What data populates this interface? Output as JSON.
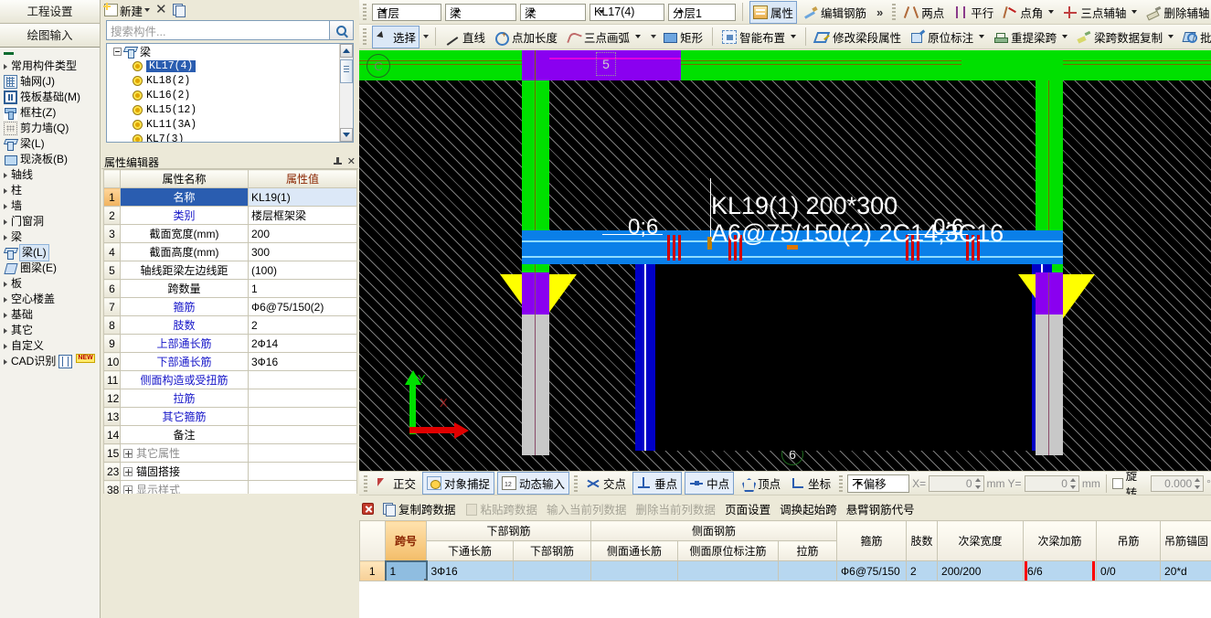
{
  "leftnav": {
    "tabs": [
      {
        "label": "工程设置"
      },
      {
        "label": "绘图输入"
      }
    ],
    "items": [
      {
        "label": "常用构件类型",
        "icon": "caret-right-icon"
      },
      {
        "label": "轴网(J)",
        "icon": "grid-icon"
      },
      {
        "label": "筏板基础(M)",
        "icon": "raft-foundation-icon"
      },
      {
        "label": "框柱(Z)",
        "icon": "frame-column-icon"
      },
      {
        "label": "剪力墙(Q)",
        "icon": "shear-wall-icon"
      },
      {
        "label": "梁(L)",
        "icon": "beam-icon"
      },
      {
        "label": "现浇板(B)",
        "icon": "slab-icon"
      },
      {
        "label": "轴线",
        "icon": "caret-right-icon"
      },
      {
        "label": "柱",
        "icon": "caret-right-icon"
      },
      {
        "label": "墙",
        "icon": "caret-right-icon"
      },
      {
        "label": "门窗洞",
        "icon": "caret-right-icon"
      },
      {
        "label": "梁",
        "icon": "caret-right-icon"
      },
      {
        "label": "梁(L)",
        "icon": "beam-icon",
        "selected": true
      },
      {
        "label": "圈梁(E)",
        "icon": "ring-beam-icon"
      },
      {
        "label": "板",
        "icon": "caret-right-icon"
      },
      {
        "label": "空心楼盖",
        "icon": "caret-right-icon"
      },
      {
        "label": "基础",
        "icon": "caret-right-icon"
      },
      {
        "label": "其它",
        "icon": "caret-right-icon"
      },
      {
        "label": "自定义",
        "icon": "caret-right-icon"
      },
      {
        "label": "CAD识别",
        "icon": "cad-recognition-icon",
        "badge": "NEW"
      }
    ]
  },
  "tree_panel": {
    "toolbar": {
      "new_label": "新建",
      "delete_icon": "close-x-icon",
      "copy_icon": "copy-icon"
    },
    "search": {
      "placeholder": "搜索构件...",
      "value": "",
      "button_icon": "search-icon"
    },
    "root": "梁",
    "nodes": [
      {
        "label": "KL17(4)",
        "selected": true
      },
      {
        "label": "KL18(2)",
        "selected": false
      },
      {
        "label": "KL16(2)",
        "selected": false
      },
      {
        "label": "KL15(12)",
        "selected": false
      },
      {
        "label": "KL11(3A)",
        "selected": false
      },
      {
        "label": "KL7(3)",
        "selected": false
      }
    ]
  },
  "property_editor": {
    "title": "属性编辑器",
    "pin_icon": "pin-icon",
    "close_icon": "close-icon",
    "headers": [
      "",
      "属性名称",
      "属性值"
    ],
    "rows": [
      {
        "idx": "1",
        "name": "名称",
        "value": "KL19(1)",
        "name_color": "blue",
        "selected": true
      },
      {
        "idx": "2",
        "name": "类别",
        "value": "楼层框架梁",
        "name_color": "blue",
        "selected": false
      },
      {
        "idx": "3",
        "name": "截面宽度(mm)",
        "value": "200",
        "name_color": "black",
        "selected": false
      },
      {
        "idx": "4",
        "name": "截面高度(mm)",
        "value": "300",
        "name_color": "black",
        "selected": false
      },
      {
        "idx": "5",
        "name": "轴线距梁左边线距",
        "value": "(100)",
        "name_color": "black",
        "selected": false
      },
      {
        "idx": "6",
        "name": "跨数量",
        "value": "1",
        "name_color": "black",
        "selected": false
      },
      {
        "idx": "7",
        "name": "箍筋",
        "value": "Ф6@75/150(2)",
        "name_color": "blue",
        "selected": false
      },
      {
        "idx": "8",
        "name": "肢数",
        "value": "2",
        "name_color": "blue",
        "selected": false
      },
      {
        "idx": "9",
        "name": "上部通长筋",
        "value": "2Ф14",
        "name_color": "blue",
        "selected": false
      },
      {
        "idx": "10",
        "name": "下部通长筋",
        "value": "3Ф16",
        "name_color": "blue",
        "selected": false
      },
      {
        "idx": "11",
        "name": "侧面构造或受扭筋",
        "value": "",
        "name_color": "blue",
        "selected": false
      },
      {
        "idx": "12",
        "name": "拉筋",
        "value": "",
        "name_color": "blue",
        "selected": false
      },
      {
        "idx": "13",
        "name": "其它箍筋",
        "value": "",
        "name_color": "blue",
        "selected": false
      },
      {
        "idx": "14",
        "name": "备注",
        "value": "",
        "name_color": "black",
        "selected": false
      },
      {
        "idx": "15",
        "name": "其它属性",
        "value": "",
        "expandable": true,
        "name_color": "grey",
        "selected": false
      },
      {
        "idx": "23",
        "name": "锚固搭接",
        "value": "",
        "expandable": true,
        "name_color": "black",
        "selected": false
      },
      {
        "idx": "38",
        "name": "显示样式",
        "value": "",
        "expandable": true,
        "name_color": "grey",
        "selected": false
      }
    ]
  },
  "top_toolbar": {
    "combos": [
      {
        "name": "floor",
        "value": "首层"
      },
      {
        "name": "category",
        "value": "梁"
      },
      {
        "name": "type",
        "value": "梁"
      },
      {
        "name": "component",
        "value": "KL17(4)"
      },
      {
        "name": "layer",
        "value": "分层1"
      }
    ],
    "buttons": [
      {
        "label": "属性",
        "icon": "properties-icon",
        "active": true
      },
      {
        "label": "编辑钢筋",
        "icon": "edit-rebar-icon",
        "active": false
      }
    ],
    "overflow": "»",
    "aux_buttons": [
      {
        "label": "两点",
        "icon": "two-point-icon",
        "dropdown": false
      },
      {
        "label": "平行",
        "icon": "parallel-icon",
        "dropdown": false
      },
      {
        "label": "点角",
        "icon": "point-angle-icon",
        "dropdown": true
      },
      {
        "label": "三点辅轴",
        "icon": "three-point-axis-icon",
        "dropdown": true
      },
      {
        "label": "删除辅轴",
        "icon": "delete-axis-icon",
        "dropdown": false
      }
    ]
  },
  "draw_toolbar": {
    "buttons": [
      {
        "label": "选择",
        "icon": "select-arrow-icon",
        "dropdown": true,
        "active": true
      },
      {
        "label": "直线",
        "icon": "line-icon",
        "dropdown": false,
        "active": false
      },
      {
        "label": "点加长度",
        "icon": "point-length-icon",
        "dropdown": false,
        "active": false
      },
      {
        "label": "三点画弧",
        "icon": "three-point-arc-icon",
        "dropdown": true,
        "active": false
      },
      {
        "label": "矩形",
        "icon": "rectangle-icon",
        "dropdown": false,
        "active": false
      },
      {
        "label": "智能布置",
        "icon": "smart-layout-icon",
        "dropdown": true,
        "active": false
      },
      {
        "label": "修改梁段属性",
        "icon": "modify-beam-icon",
        "dropdown": false,
        "active": false
      },
      {
        "label": "原位标注",
        "icon": "in-situ-label-icon",
        "dropdown": true,
        "active": false
      },
      {
        "label": "重提梁跨",
        "icon": "re-extract-span-icon",
        "dropdown": true,
        "active": false
      },
      {
        "label": "梁跨数据复制",
        "icon": "copy-span-data-icon",
        "dropdown": true,
        "active": false
      },
      {
        "label": "批量识",
        "icon": "batch-recognize-icon",
        "dropdown": false,
        "active": false
      }
    ]
  },
  "canvas": {
    "beam_label_line1": "KL19(1) 200*300",
    "beam_label_line2": "A6@75/150(2) 2C14;3C16",
    "span_marks": [
      "0;6",
      "0;6",
      "0;6"
    ],
    "axis_x_label": "X",
    "axis_y_label": "Y",
    "grid_left_label": "C",
    "grid_top_label": "5",
    "grid_bottom_label": "6"
  },
  "status_bar": {
    "buttons": [
      {
        "label": "正交",
        "icon": "ortho-icon",
        "active": false
      },
      {
        "label": "对象捕捉",
        "icon": "object-snap-icon",
        "active": true
      },
      {
        "label": "动态输入",
        "icon": "dynamic-input-icon",
        "active": true
      },
      {
        "label": "交点",
        "icon": "intersection-icon",
        "active": false
      },
      {
        "label": "垂点",
        "icon": "perpendicular-icon",
        "active": true
      },
      {
        "label": "中点",
        "icon": "midpoint-icon",
        "active": true
      },
      {
        "label": "顶点",
        "icon": "vertex-icon",
        "active": false
      },
      {
        "label": "坐标",
        "icon": "coordinate-icon",
        "active": false
      }
    ],
    "offset_mode": "不偏移",
    "x_label": "X=",
    "x_value": "0",
    "x_unit": "mm",
    "y_label": "Y=",
    "y_value": "0",
    "y_unit": "mm",
    "rotate_label": "旋转",
    "rotate_value": "0.000",
    "rotate_unit": "°"
  },
  "span_toolbar": {
    "close_icon": "close-panel-icon",
    "buttons": [
      {
        "label": "复制跨数据",
        "icon": "copy-icon",
        "disabled": false
      },
      {
        "label": "粘贴跨数据",
        "icon": "paste-icon",
        "disabled": true
      },
      {
        "label": "输入当前列数据",
        "icon": "",
        "disabled": true
      },
      {
        "label": "删除当前列数据",
        "icon": "",
        "disabled": true
      },
      {
        "label": "页面设置",
        "icon": "",
        "disabled": false
      },
      {
        "label": "调换起始跨",
        "icon": "",
        "disabled": false
      },
      {
        "label": "悬臂钢筋代号",
        "icon": "",
        "disabled": false
      }
    ]
  },
  "span_table": {
    "group_headers": [
      {
        "label": "",
        "colspan": 1
      },
      {
        "label": "跨号",
        "colspan": 1,
        "rowspan": 2,
        "accent": true
      },
      {
        "label": "下部钢筋",
        "colspan": 2
      },
      {
        "label": "侧面钢筋",
        "colspan": 3
      },
      {
        "label": "箍筋",
        "colspan": 1,
        "rowspan": 2
      },
      {
        "label": "肢数",
        "colspan": 1,
        "rowspan": 2
      },
      {
        "label": "次梁宽度",
        "colspan": 1,
        "rowspan": 2
      },
      {
        "label": "次梁加筋",
        "colspan": 1,
        "rowspan": 2
      },
      {
        "label": "吊筋",
        "colspan": 1,
        "rowspan": 2
      },
      {
        "label": "吊筋锚固",
        "colspan": 1,
        "rowspan": 2
      }
    ],
    "sub_headers": [
      "下通长筋",
      "下部钢筋",
      "侧面通长筋",
      "侧面原位标注筋",
      "拉筋"
    ],
    "rows": [
      {
        "row_index": "1",
        "span_no": "1",
        "bottom_through": "3Ф16",
        "bottom_rebar": "",
        "side_through": "",
        "side_in_situ": "",
        "tie_rebar": "",
        "stirrup": "Ф6@75/150",
        "legs": "2",
        "secondary_beam_width": "200/200",
        "secondary_beam_rebar": "6/6",
        "hanger": "0/0",
        "hanger_anchor": "20*d"
      }
    ],
    "highlight_color": "#ff0000",
    "selected_cell": "span_no",
    "highlighted_cell": "secondary_beam_rebar"
  }
}
